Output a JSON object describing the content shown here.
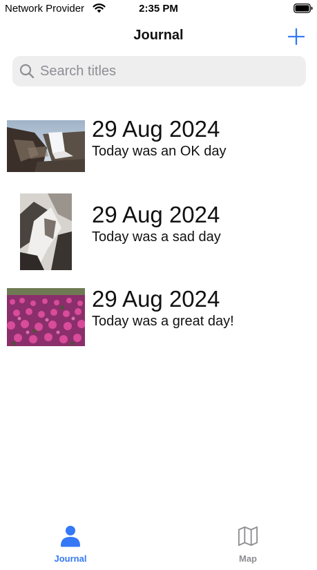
{
  "status_bar": {
    "carrier": "Network Provider",
    "time": "2:35 PM"
  },
  "nav": {
    "title": "Journal",
    "add_icon": "plus-icon"
  },
  "search": {
    "placeholder": "Search titles",
    "value": "",
    "icon": "magnifying-glass-icon"
  },
  "entries": [
    {
      "date": "29 Aug 2024",
      "text": "Today was an OK day",
      "image": "waterfall-rocks-photo"
    },
    {
      "date": "29 Aug 2024",
      "text": "Today was a sad day",
      "image": "rocky-stream-photo"
    },
    {
      "date": "29 Aug 2024",
      "text": "Today was a great day!",
      "image": "pink-flower-field-photo"
    }
  ],
  "tab_bar": {
    "tabs": [
      {
        "label": "Journal",
        "icon": "person-icon",
        "selected": true
      },
      {
        "label": "Map",
        "icon": "map-icon",
        "selected": false
      }
    ]
  },
  "colors": {
    "accent": "#3478f6",
    "inactive_tab": "#8e8e93",
    "search_background": "#eeeeef"
  }
}
